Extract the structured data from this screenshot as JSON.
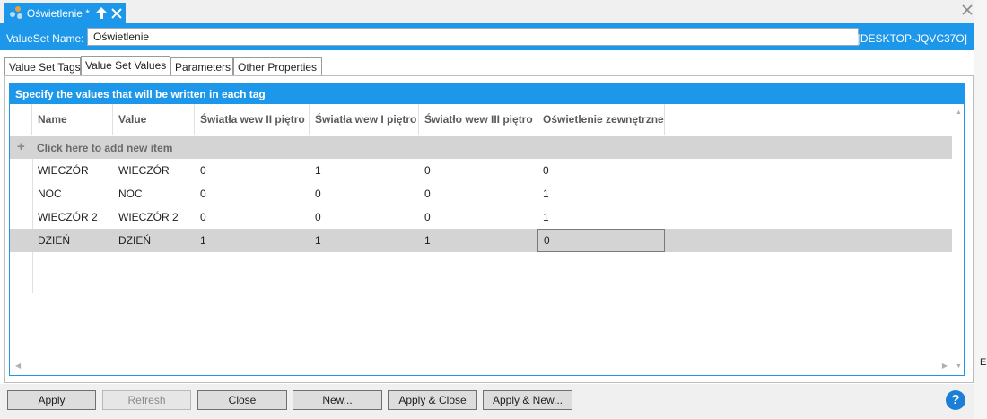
{
  "window": {
    "tab_title": "Oświetlenie *",
    "host": "[DESKTOP-JQVC37O]",
    "side_label": "E"
  },
  "valueset": {
    "name_label": "ValueSet Name:",
    "name_value": "Oświetlenie"
  },
  "tabs": [
    {
      "label": "Value Set Tags",
      "active": false
    },
    {
      "label": "Value Set Values",
      "active": true
    },
    {
      "label": "Parameters",
      "active": false
    },
    {
      "label": "Other Properties",
      "active": false
    }
  ],
  "panel": {
    "title": "Specify the values that will be written in each tag",
    "add_item": "Click here to add new item",
    "columns": [
      "Name",
      "Value",
      "Światła wew II piętro",
      "Światła wew I piętro",
      "Światło wew III piętro",
      "Oświetlenie zewnętrzne"
    ],
    "rows": [
      {
        "cells": [
          "WIECZÓR",
          "WIECZÓR",
          "0",
          "1",
          "0",
          "0"
        ],
        "selected": false
      },
      {
        "cells": [
          "NOC",
          "NOC",
          "0",
          "0",
          "0",
          "1"
        ],
        "selected": false
      },
      {
        "cells": [
          "WIECZÓR 2",
          "WIECZÓR 2",
          "0",
          "0",
          "0",
          "1"
        ],
        "selected": false
      },
      {
        "cells": [
          "DZIEŃ",
          "DZIEŃ",
          "1",
          "1",
          "1",
          "0"
        ],
        "selected": true
      }
    ]
  },
  "buttons": {
    "apply": "Apply",
    "refresh": "Refresh",
    "close": "Close",
    "new": "New...",
    "apply_close": "Apply & Close",
    "apply_new": "Apply & New...",
    "help": "?"
  },
  "colors": {
    "accent": "#1c97ea",
    "selected_row": "#d4d4d4"
  },
  "icons": [
    "valueset-icon",
    "pin-icon",
    "close-icon",
    "window-close-icon",
    "plus-icon",
    "help-icon"
  ]
}
